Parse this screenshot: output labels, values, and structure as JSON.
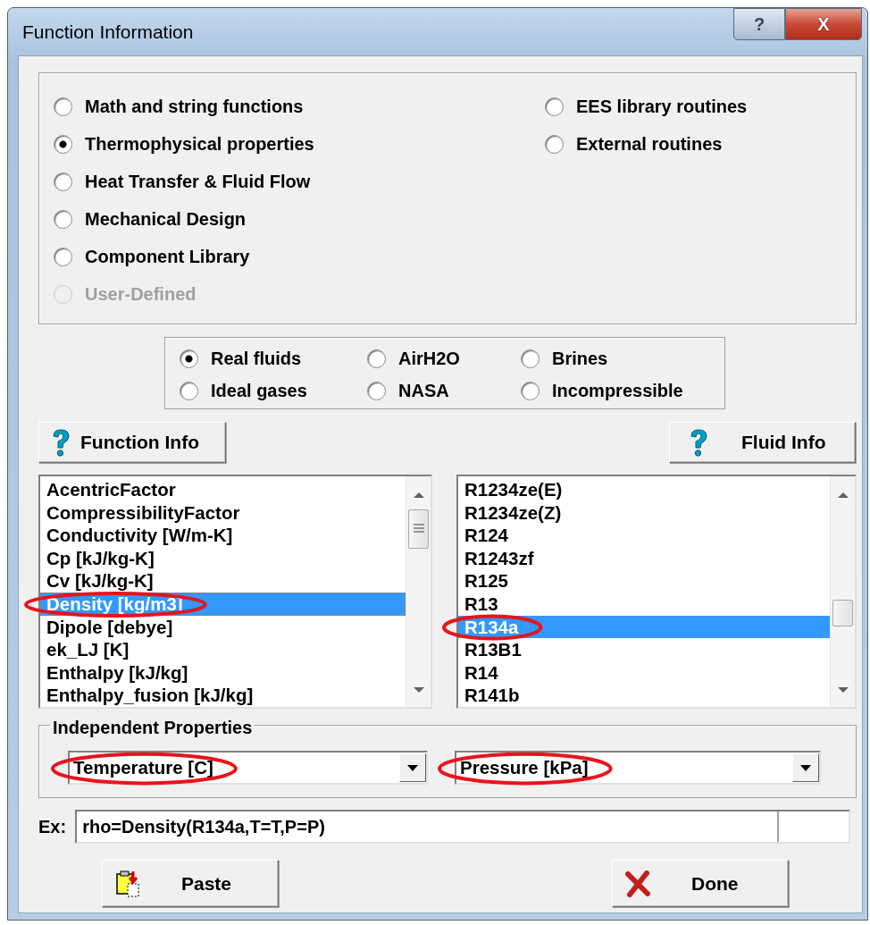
{
  "window": {
    "title": "Function Information"
  },
  "title_buttons": [
    {
      "kind": "help",
      "label": "?"
    },
    {
      "kind": "close",
      "label": "X"
    }
  ],
  "categories": [
    {
      "label": "Math and string functions",
      "selected": false,
      "disabled": false
    },
    {
      "label": "Thermophysical properties",
      "selected": true,
      "disabled": false
    },
    {
      "label": "Heat Transfer & Fluid Flow",
      "selected": false,
      "disabled": false
    },
    {
      "label": "Mechanical Design",
      "selected": false,
      "disabled": false
    },
    {
      "label": "Component Library",
      "selected": false,
      "disabled": false
    },
    {
      "label": "User-Defined",
      "selected": false,
      "disabled": true
    },
    {
      "label": "EES library routines",
      "selected": false,
      "disabled": false
    },
    {
      "label": "External routines",
      "selected": false,
      "disabled": false
    }
  ],
  "fluid_types": [
    {
      "label": "Real fluids",
      "selected": true
    },
    {
      "label": "AirH2O",
      "selected": false
    },
    {
      "label": "Brines",
      "selected": false
    },
    {
      "label": "Ideal gases",
      "selected": false
    },
    {
      "label": "NASA",
      "selected": false
    },
    {
      "label": "Incompressible",
      "selected": false
    }
  ],
  "function_info_button": {
    "label": "Function Info"
  },
  "fluid_info_button": {
    "label": "Fluid Info"
  },
  "function_list": [
    {
      "label": "AcentricFactor",
      "selected": false,
      "circled": false
    },
    {
      "label": "CompressibilityFactor",
      "selected": false,
      "circled": false
    },
    {
      "label": "Conductivity [W/m-K]",
      "selected": false,
      "circled": false
    },
    {
      "label": "Cp [kJ/kg-K]",
      "selected": false,
      "circled": false
    },
    {
      "label": "Cv [kJ/kg-K]",
      "selected": false,
      "circled": false
    },
    {
      "label": "Density [kg/m3]",
      "selected": true,
      "circled": true
    },
    {
      "label": "Dipole [debye]",
      "selected": false,
      "circled": false
    },
    {
      "label": "ek_LJ [K]",
      "selected": false,
      "circled": false
    },
    {
      "label": "Enthalpy [kJ/kg]",
      "selected": false,
      "circled": false
    },
    {
      "label": "Enthalpy_fusion [kJ/kg]",
      "selected": false,
      "circled": false
    }
  ],
  "fluid_list": [
    {
      "label": "R1234ze(E)",
      "selected": false,
      "circled": false
    },
    {
      "label": "R1234ze(Z)",
      "selected": false,
      "circled": false
    },
    {
      "label": "R124",
      "selected": false,
      "circled": false
    },
    {
      "label": "R1243zf",
      "selected": false,
      "circled": false
    },
    {
      "label": "R125",
      "selected": false,
      "circled": false
    },
    {
      "label": "R13",
      "selected": false,
      "circled": false
    },
    {
      "label": "R134a",
      "selected": true,
      "circled": true
    },
    {
      "label": "R13B1",
      "selected": false,
      "circled": false
    },
    {
      "label": "R14",
      "selected": false,
      "circled": false
    },
    {
      "label": "R141b",
      "selected": false,
      "circled": false
    }
  ],
  "independent_properties": {
    "title": "Independent Properties",
    "selects": [
      {
        "value": "Temperature [C]",
        "circled": true
      },
      {
        "value": "Pressure [kPa]",
        "circled": true
      }
    ]
  },
  "example": {
    "label": "Ex:",
    "value": "rho=Density(R134a,T=T,P=P)"
  },
  "buttons": [
    {
      "kind": "paste",
      "label": "Paste"
    },
    {
      "kind": "done",
      "label": "Done"
    }
  ]
}
